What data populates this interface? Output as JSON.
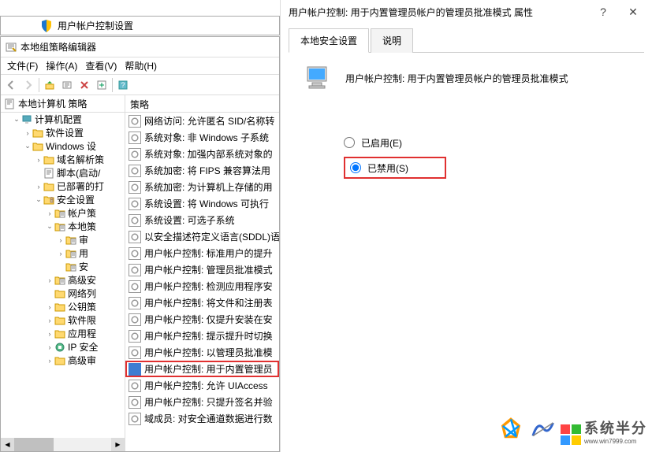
{
  "bg_window": {
    "title": "用户帐户控制设置"
  },
  "policy_editor": {
    "title": "本地组策略编辑器",
    "menus": {
      "file": "文件(F)",
      "action": "操作(A)",
      "view": "查看(V)",
      "help": "帮助(H)"
    },
    "tree_header": "本地计算机 策略",
    "tree_items": [
      {
        "indent": 1,
        "exp": "v",
        "icon": "computer",
        "label": "计算机配置"
      },
      {
        "indent": 2,
        "exp": ">",
        "icon": "folder",
        "label": "软件设置"
      },
      {
        "indent": 2,
        "exp": "v",
        "icon": "folder",
        "label": "Windows 设"
      },
      {
        "indent": 3,
        "exp": ">",
        "icon": "folder",
        "label": "域名解析策"
      },
      {
        "indent": 3,
        "exp": "",
        "icon": "script",
        "label": "脚本(启动/"
      },
      {
        "indent": 3,
        "exp": ">",
        "icon": "folder",
        "label": "已部署的打"
      },
      {
        "indent": 3,
        "exp": "v",
        "icon": "security",
        "label": "安全设置"
      },
      {
        "indent": 4,
        "exp": ">",
        "icon": "policy",
        "label": "帐户策"
      },
      {
        "indent": 4,
        "exp": "v",
        "icon": "policy",
        "label": "本地策"
      },
      {
        "indent": 5,
        "exp": ">",
        "icon": "policy",
        "label": "审"
      },
      {
        "indent": 5,
        "exp": ">",
        "icon": "policy",
        "label": "用"
      },
      {
        "indent": 5,
        "exp": "",
        "icon": "policy-sel",
        "label": "安"
      },
      {
        "indent": 4,
        "exp": ">",
        "icon": "policy",
        "label": "高级安"
      },
      {
        "indent": 4,
        "exp": "",
        "icon": "folder",
        "label": "网络列"
      },
      {
        "indent": 4,
        "exp": ">",
        "icon": "folder",
        "label": "公钥策"
      },
      {
        "indent": 4,
        "exp": ">",
        "icon": "folder",
        "label": "软件限"
      },
      {
        "indent": 4,
        "exp": ">",
        "icon": "folder",
        "label": "应用程"
      },
      {
        "indent": 4,
        "exp": ">",
        "icon": "ipsec",
        "label": "IP 安全"
      },
      {
        "indent": 4,
        "exp": ">",
        "icon": "folder",
        "label": "高级审"
      }
    ],
    "list_header": "策略",
    "list_items": [
      {
        "label": "网络访问: 允许匿名 SID/名称转"
      },
      {
        "label": "系统对象: 非 Windows 子系统"
      },
      {
        "label": "系统对象: 加强内部系统对象的"
      },
      {
        "label": "系统加密: 将 FIPS 兼容算法用"
      },
      {
        "label": "系统加密: 为计算机上存储的用"
      },
      {
        "label": "系统设置: 将 Windows 可执行"
      },
      {
        "label": "系统设置: 可选子系统"
      },
      {
        "label": "以安全描述符定义语言(SDDL)语"
      },
      {
        "label": "用户帐户控制: 标准用户的提升"
      },
      {
        "label": "用户帐户控制: 管理员批准模式"
      },
      {
        "label": "用户帐户控制: 检测应用程序安"
      },
      {
        "label": "用户帐户控制: 将文件和注册表"
      },
      {
        "label": "用户帐户控制: 仅提升安装在安"
      },
      {
        "label": "用户帐户控制: 提示提升时切换"
      },
      {
        "label": "用户帐户控制: 以管理员批准模"
      },
      {
        "label": "用户帐户控制: 用于内置管理员",
        "selected": true
      },
      {
        "label": "用户帐户控制: 允许 UIAccess"
      },
      {
        "label": "用户帐户控制: 只提升签名并验"
      },
      {
        "label": "域成员: 对安全通道数据进行数"
      }
    ]
  },
  "props": {
    "title": "用户帐户控制: 用于内置管理员帐户的管理员批准模式 属性",
    "tabs": {
      "local": "本地安全设置",
      "explain": "说明"
    },
    "policy_name": "用户帐户控制: 用于内置管理员帐户的管理员批准模式",
    "radio_enabled": "已启用(E)",
    "radio_disabled": "已禁用(S)",
    "selected_value": "disabled"
  },
  "branding": {
    "text": "系统半分",
    "url": "www.win7999.com"
  }
}
